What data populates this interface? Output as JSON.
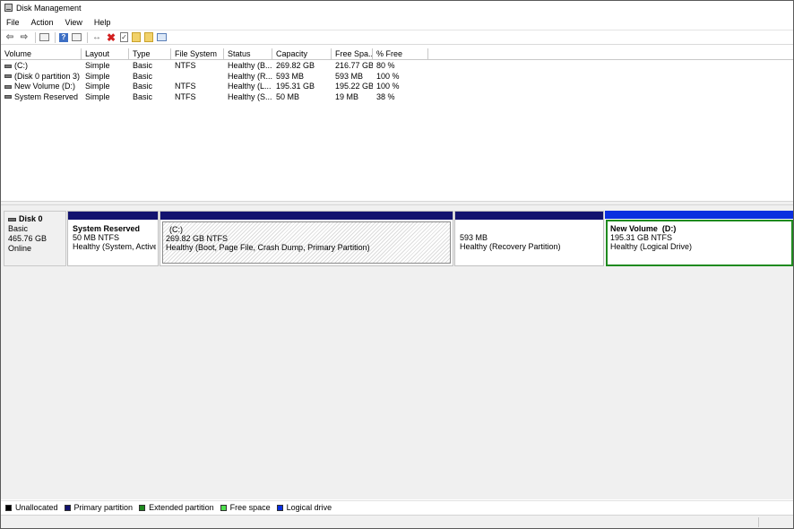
{
  "window": {
    "title": "Disk Management"
  },
  "menu": [
    "File",
    "Action",
    "View",
    "Help"
  ],
  "toolbar": {
    "icons": [
      "back-arrow-icon",
      "forward-arrow-icon",
      "console-tree-icon",
      "help-icon",
      "properties-icon",
      "connect-icon",
      "delete-icon",
      "check-icon",
      "new-folder-icon",
      "open-folder-icon",
      "drive-icon"
    ]
  },
  "volume_table": {
    "columns": [
      "Volume",
      "Layout",
      "Type",
      "File System",
      "Status",
      "Capacity",
      "Free Spa...",
      "% Free"
    ],
    "rows": [
      {
        "volume": "(C:)",
        "layout": "Simple",
        "type": "Basic",
        "fs": "NTFS",
        "status": "Healthy (B...",
        "capacity": "269.82 GB",
        "free": "216.77 GB",
        "pct": "80 %"
      },
      {
        "volume": "(Disk 0 partition 3)",
        "layout": "Simple",
        "type": "Basic",
        "fs": "",
        "status": "Healthy (R...",
        "capacity": "593 MB",
        "free": "593 MB",
        "pct": "100 %"
      },
      {
        "volume": "New Volume (D:)",
        "layout": "Simple",
        "type": "Basic",
        "fs": "NTFS",
        "status": "Healthy (L...",
        "capacity": "195.31 GB",
        "free": "195.22 GB",
        "pct": "100 %"
      },
      {
        "volume": "System Reserved",
        "layout": "Simple",
        "type": "Basic",
        "fs": "NTFS",
        "status": "Healthy (S...",
        "capacity": "50 MB",
        "free": "19 MB",
        "pct": "38 %"
      }
    ]
  },
  "disk": {
    "name": "Disk 0",
    "type": "Basic",
    "size": "465.76 GB",
    "state": "Online",
    "partitions": [
      {
        "name": "System Reserved",
        "size": "50 MB NTFS",
        "status": "Healthy (System, Active, Primary Partition)"
      },
      {
        "name": "(C:)",
        "size": "269.82 GB NTFS",
        "status": "Healthy (Boot, Page File, Crash Dump, Primary Partition)"
      },
      {
        "name": "",
        "size": "593 MB",
        "status": "Healthy (Recovery Partition)"
      },
      {
        "name": "New Volume  (D:)",
        "size": "195.31 GB NTFS",
        "status": "Healthy (Logical Drive)"
      }
    ]
  },
  "legend": [
    {
      "label": "Unallocated",
      "color": "#000000"
    },
    {
      "label": "Primary partition",
      "color": "#13136f"
    },
    {
      "label": "Extended partition",
      "color": "#1f8a1f"
    },
    {
      "label": "Free space",
      "color": "#4ee04e"
    },
    {
      "label": "Logical drive",
      "color": "#0a2fe0"
    }
  ]
}
